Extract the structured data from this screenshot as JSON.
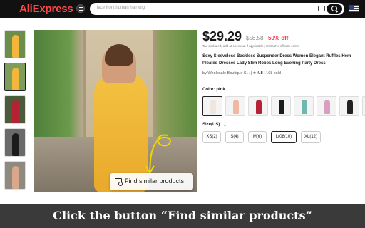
{
  "header": {
    "logo": "AliExpress",
    "search_placeholder": "lace front human hair wig"
  },
  "icons": {
    "menu": "menu-icon",
    "camera": "camera-icon",
    "search": "search-icon",
    "flag": "us-flag-icon",
    "find_similar": "image-search-icon"
  },
  "colors": {
    "brand": "#ff4747",
    "discount": "#fd384f",
    "header_bg": "#111111",
    "dress": "#f3c242"
  },
  "thumbnails": [
    {
      "color": "#f2b73a",
      "selected": false
    },
    {
      "color": "#f2b73a",
      "selected": true
    },
    {
      "color": "#b52234",
      "selected": false
    },
    {
      "color": "#1b1b1b",
      "selected": false
    },
    {
      "color": "#d9a88c",
      "selected": false
    }
  ],
  "product": {
    "price": "$29.29",
    "old_price": "$58.58",
    "discount": "50% off",
    "tax_note": "Tax excluded, add at checkout if applicable ; Extra 2% off with coins",
    "title": "Sexy Sleeveless Backless Suspender Dress Women Elegant Ruffles Hem Pleated Dresses Lady Slim Robes Long Evening Party Dress",
    "store_prefix": "by",
    "store_name": "Wholesale Boutique S...",
    "rating": "4.8",
    "sold": "168 sold"
  },
  "color_option": {
    "label": "Color: pink",
    "swatches": [
      "#f0e6e0",
      "#f0b8a0",
      "#b52234",
      "#1b1b1b",
      "#6fb6b0",
      "#d8a0c0",
      "#222222",
      "#9e2a3a"
    ]
  },
  "size_option": {
    "label": "Size(US)",
    "sizes": [
      {
        "label": "XS(2)",
        "selected": false
      },
      {
        "label": "S(4)",
        "selected": false
      },
      {
        "label": "M(6)",
        "selected": false
      },
      {
        "label": "L(08/10)",
        "selected": true
      },
      {
        "label": "XL(12)",
        "selected": false
      }
    ]
  },
  "find_similar_button": {
    "label": "Find similar products"
  },
  "instruction": {
    "text": "Click the button “Find similar products”"
  }
}
